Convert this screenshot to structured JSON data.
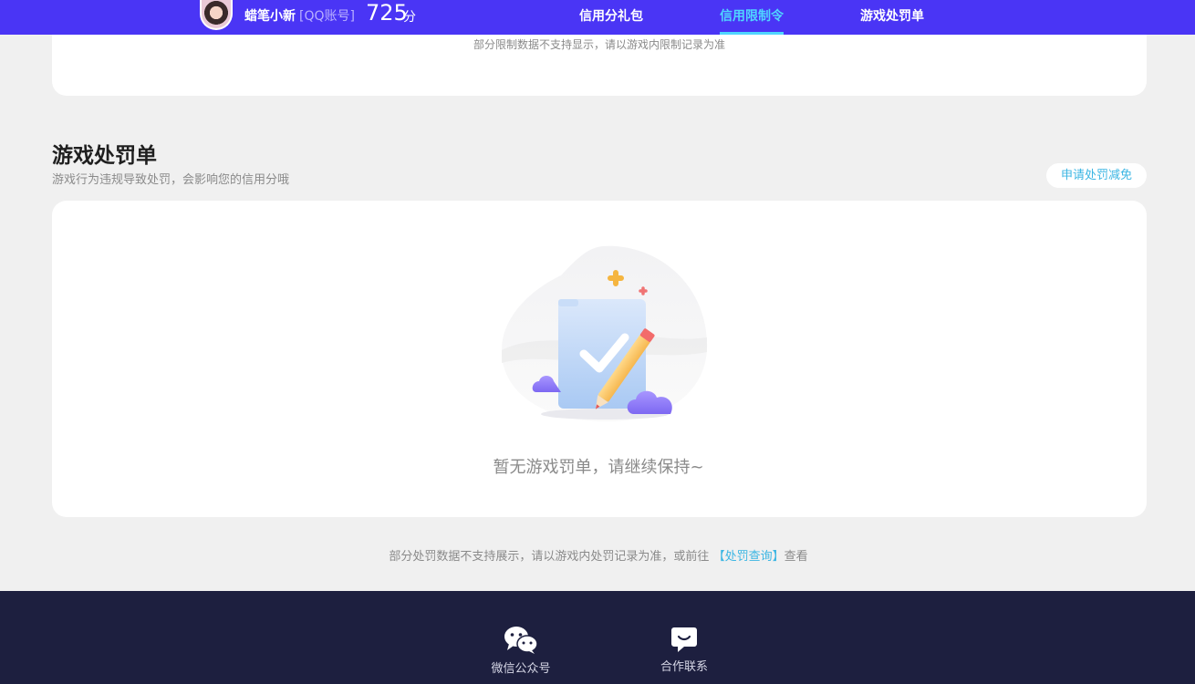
{
  "header": {
    "username": "蜡笔小新",
    "account_type": "[QQ账号]",
    "score": "725",
    "score_unit": "分",
    "nav": [
      {
        "label": "信用分礼包",
        "active": false
      },
      {
        "label": "信用限制令",
        "active": true
      },
      {
        "label": "游戏处罚单",
        "active": false
      }
    ]
  },
  "restriction_section": {
    "note": "部分限制数据不支持显示，请以游戏内限制记录为准"
  },
  "penalty_section": {
    "title": "游戏处罚单",
    "subtitle": "游戏行为违规导致处罚，会影响您的信用分哦",
    "apply_button": "申请处罚减免",
    "empty_text": "暂无游戏罚单，请继续保持~",
    "note_prefix": "部分处罚数据不支持展示，请以游戏内处罚记录为准，或前往",
    "note_link": "【处罚查询】",
    "note_suffix": "查看"
  },
  "footer": {
    "items": [
      {
        "label": "微信公众号",
        "icon": "wechat-icon"
      },
      {
        "label": "合作联系",
        "icon": "chat-icon"
      }
    ]
  },
  "colors": {
    "brand": "#4a35f5",
    "active_nav": "#4fd6ff",
    "link": "#3cb6e3",
    "footer_bg": "#1d1f3f"
  }
}
